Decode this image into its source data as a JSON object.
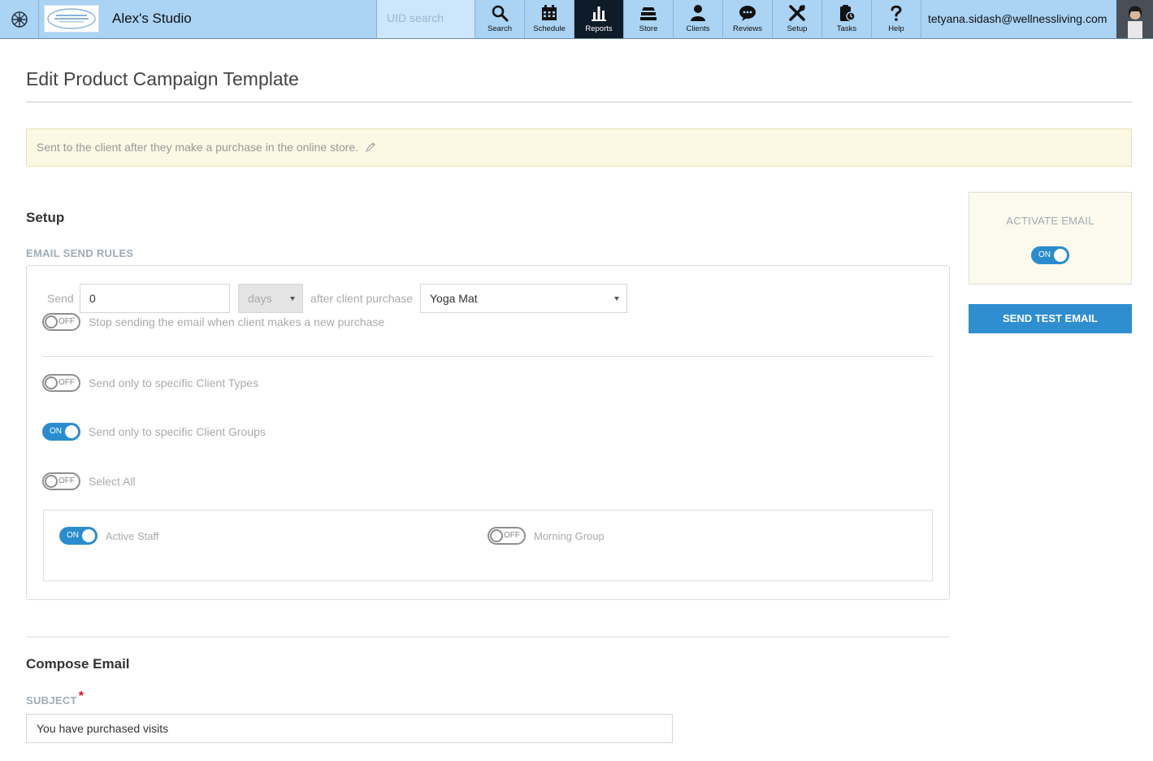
{
  "header": {
    "studio_name": "Alex's Studio",
    "uid_placeholder": "UID search",
    "user_email": "tetyana.sidash@wellnessliving.com",
    "nav": [
      {
        "label": "Search",
        "icon": "search-icon",
        "active": false
      },
      {
        "label": "Schedule",
        "icon": "calendar-icon",
        "active": false
      },
      {
        "label": "Reports",
        "icon": "bar-chart-icon",
        "active": true
      },
      {
        "label": "Store",
        "icon": "store-icon",
        "active": false
      },
      {
        "label": "Clients",
        "icon": "person-icon",
        "active": false
      },
      {
        "label": "Reviews",
        "icon": "speech-bubble-icon",
        "active": false
      },
      {
        "label": "Setup",
        "icon": "tools-icon",
        "active": false
      },
      {
        "label": "Tasks",
        "icon": "clipboard-icon",
        "active": false
      },
      {
        "label": "Help",
        "icon": "question-icon",
        "active": false
      }
    ]
  },
  "page": {
    "title": "Edit Product Campaign Template",
    "notice": "Sent to the client after they make a purchase in the online store."
  },
  "setup": {
    "heading": "Setup",
    "rules_label": "EMAIL SEND RULES",
    "send_label": "Send",
    "send_value": "0",
    "unit_value": "days",
    "after_label": "after client purchase",
    "product_value": "Yoga Mat",
    "toggles": {
      "stop_sending": {
        "state": "OFF",
        "label": "Stop sending the email when client makes a new purchase"
      },
      "client_types": {
        "state": "OFF",
        "label": "Send only to specific Client Types"
      },
      "client_groups": {
        "state": "ON",
        "label": "Send only to specific Client Groups"
      },
      "select_all": {
        "state": "OFF",
        "label": "Select All"
      }
    },
    "groups": [
      {
        "state": "ON",
        "label": "Active Staff"
      },
      {
        "state": "OFF",
        "label": "Morning Group"
      }
    ]
  },
  "sidebar": {
    "activate_label": "ACTIVATE EMAIL",
    "activate_state": "ON",
    "test_button": "SEND TEST EMAIL"
  },
  "compose": {
    "heading": "Compose Email",
    "subject_label": "SUBJECT",
    "required_mark": "*",
    "subject_value": "You have purchased visits"
  },
  "colors": {
    "topbar": "#aad3f4",
    "active_nav": "#0e1b29",
    "accent": "#2b8ccd",
    "notice_bg": "#fbf8e4"
  }
}
